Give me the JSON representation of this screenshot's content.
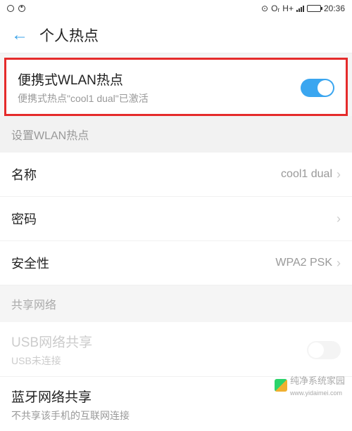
{
  "status": {
    "hotspot": "⊙",
    "key": "Oᵣ",
    "hplus": "H+",
    "time": "20:36"
  },
  "header": {
    "title": "个人热点"
  },
  "portable": {
    "title": "便携式WLAN热点",
    "subtitle": "便携式热点\"cool1 dual\"已激活"
  },
  "section1": {
    "title": "设置WLAN热点"
  },
  "rows": {
    "name": {
      "label": "名称",
      "value": "cool1 dual"
    },
    "password": {
      "label": "密码",
      "value": ""
    },
    "security": {
      "label": "安全性",
      "value": "WPA2 PSK"
    }
  },
  "section2": {
    "title": "共享网络"
  },
  "usb": {
    "title": "USB网络共享",
    "subtitle": "USB未连接"
  },
  "bt": {
    "title": "蓝牙网络共享",
    "subtitle": "不共享该手机的互联网连接"
  },
  "watermark": {
    "brand": "纯净系统家园",
    "url": "www.yidaimei.com"
  }
}
